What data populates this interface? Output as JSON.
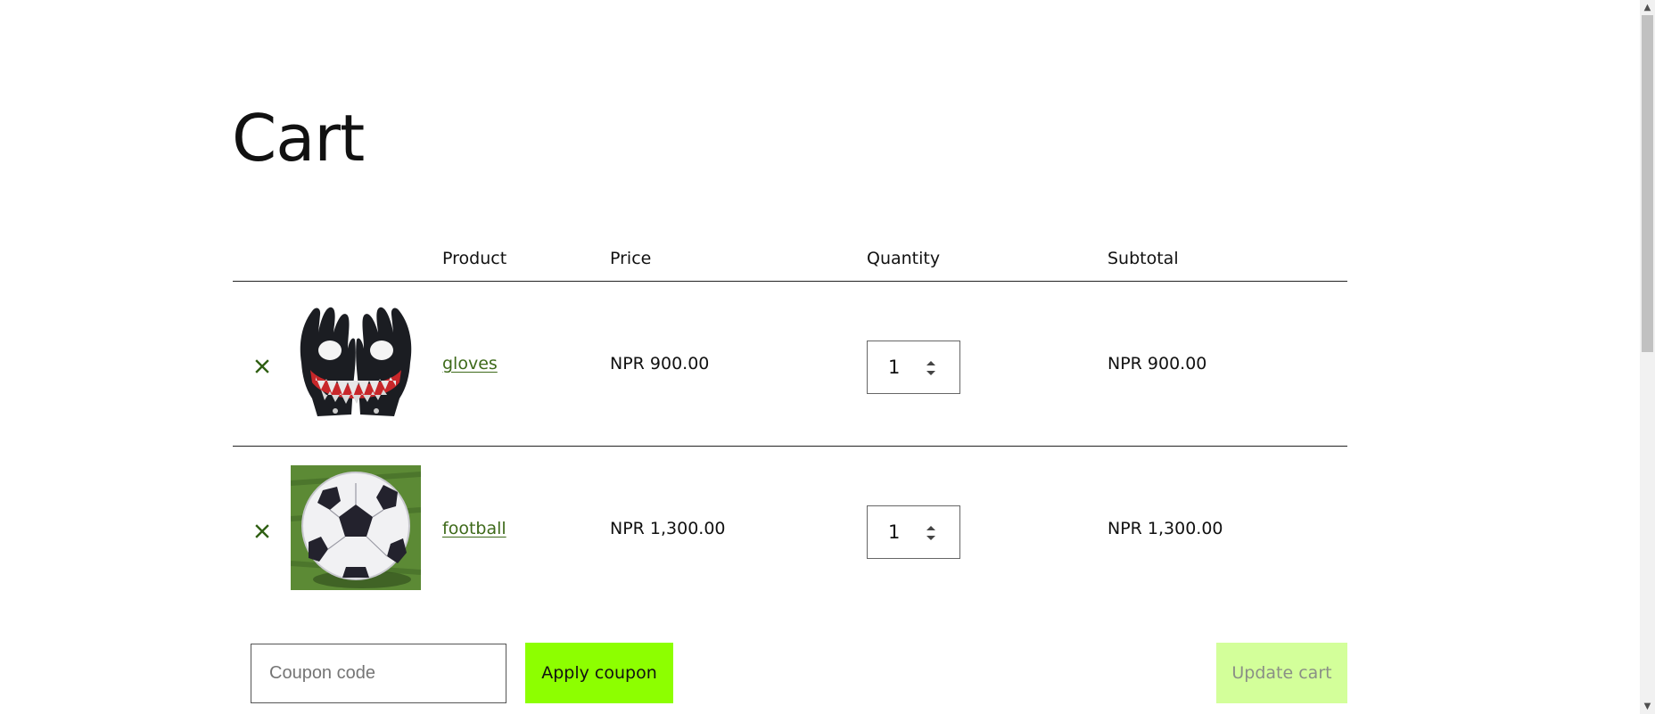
{
  "page": {
    "title": "Cart"
  },
  "table": {
    "headers": {
      "product": "Product",
      "price": "Price",
      "quantity": "Quantity",
      "subtotal": "Subtotal"
    },
    "items": [
      {
        "name": "gloves",
        "price": "NPR 900.00",
        "quantity": "1",
        "subtotal": "NPR 900.00",
        "remove_icon": "close-icon",
        "thumbnail": "gloves-image"
      },
      {
        "name": "football",
        "price": "NPR 1,300.00",
        "quantity": "1",
        "subtotal": "NPR 1,300.00",
        "remove_icon": "close-icon",
        "thumbnail": "football-image"
      }
    ]
  },
  "actions": {
    "coupon_placeholder": "Coupon code",
    "apply_label": "Apply coupon",
    "update_label": "Update cart"
  },
  "colors": {
    "accent": "#8dff00",
    "accent_disabled": "#d3ff9a",
    "link": "#3e6a1a",
    "remove": "#2f5f12"
  },
  "icons": {
    "remove": "close-icon",
    "quantity_spinner": "spinner-arrows-icon",
    "scroll_up": "chevron-up-icon",
    "scroll_down": "chevron-down-icon"
  }
}
